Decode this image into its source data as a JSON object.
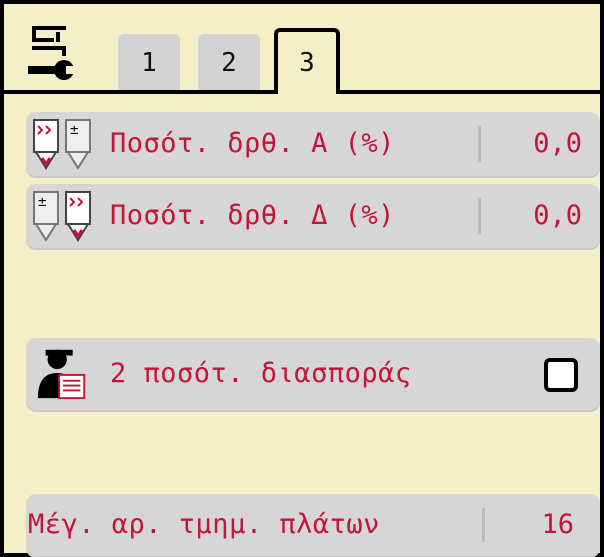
{
  "tabs": [
    {
      "label": "1",
      "active": false
    },
    {
      "label": "2",
      "active": false
    },
    {
      "label": "3",
      "active": true
    }
  ],
  "rows": {
    "qty_a": {
      "label": "Ποσότ. δρθ. Α (%)",
      "value": "0,0"
    },
    "qty_d": {
      "label": "Ποσότ. δρθ. Δ (%)",
      "value": "0,0"
    },
    "spread": {
      "label": "2 ποσότ. διασποράς",
      "checked": false
    },
    "max_sections": {
      "label": "Μέγ. αρ. τμημ. πλάτων",
      "value": "16"
    }
  },
  "colors": {
    "background": "#f4efc6",
    "row": "#d6d6d6",
    "text": "#c3143a",
    "icon_red": "#c3143a"
  },
  "icons": {
    "menu": "settings-wrench-icon",
    "qty_a": "quantity-adjust-left-icon",
    "qty_d": "quantity-adjust-right-icon",
    "spread": "operator-icon"
  }
}
